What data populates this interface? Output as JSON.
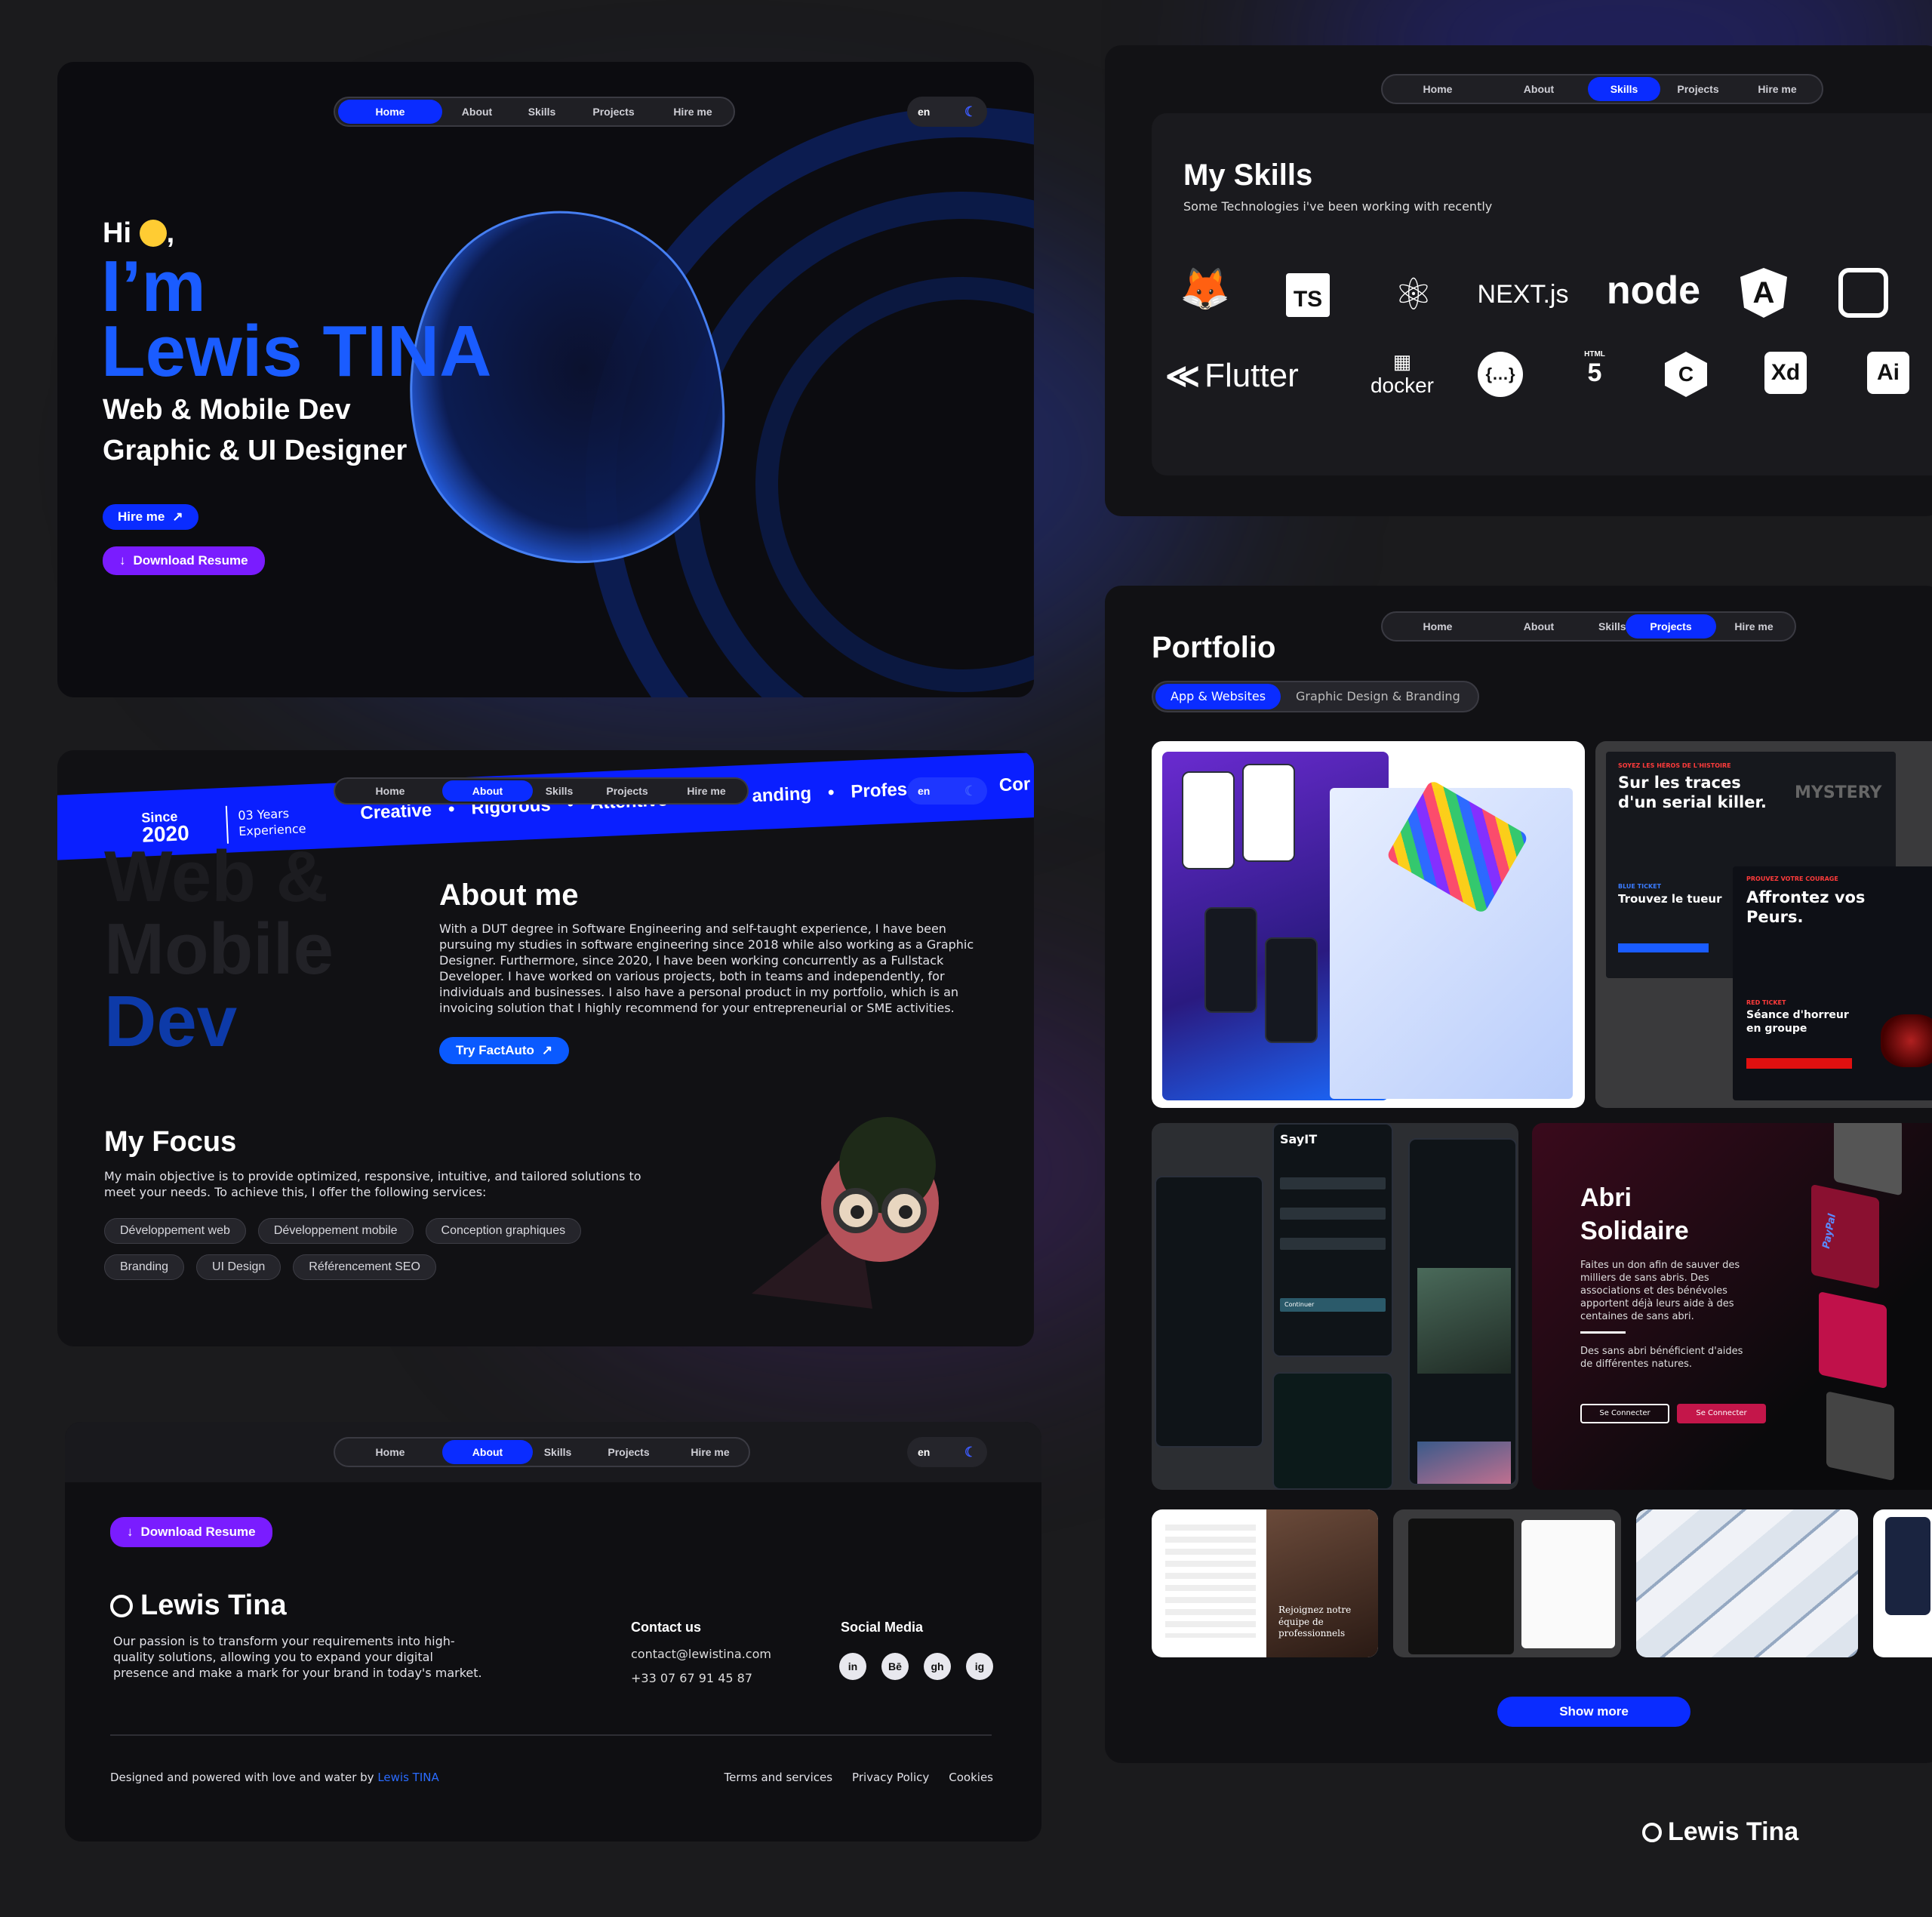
{
  "nav": {
    "home": "Home",
    "about": "About",
    "skills": "Skills",
    "projects": "Projects",
    "hire": "Hire me",
    "lang": "en"
  },
  "hero": {
    "hi": "Hi",
    "comma": ",",
    "im": "I’m",
    "name": "Lewis TINA",
    "role1": "Web & Mobile Dev",
    "role2": "Graphic & UI Designer",
    "hire_btn": "Hire me",
    "download_btn": "Download Resume"
  },
  "skills": {
    "title": "My Skills",
    "subtitle": "Some Technologies i've been working with recently",
    "row1": [
      "TS",
      "NEXT.js",
      "node"
    ],
    "row2": [
      "Flutter",
      "docker",
      "HTML",
      "Xd",
      "Ai"
    ]
  },
  "about": {
    "since_label": "Since",
    "since_year": "2020",
    "exp_years": "03 Years",
    "exp_label": "Experience",
    "ribbon": [
      "Creative",
      "•",
      "Rigorous",
      "•",
      "Attentive",
      "anding",
      "•",
      "Profes",
      "Cor"
    ],
    "bg_words": [
      "Web &",
      "Mobile",
      "Dev"
    ],
    "title": "About me",
    "text": "With a DUT degree in Software Engineering and self-taught experience, I have been pursuing my studies in software engineering since 2018 while also working as a Graphic Designer. Furthermore, since 2020, I have been working concurrently as a Fullstack Developer. I have worked on various projects, both in teams and independently, for individuals and businesses. I also have a personal product in my portfolio, which is an invoicing solution that I highly recommend for your entrepreneurial or SME activities.",
    "try_btn": "Try FactAuto",
    "focus_title": "My Focus",
    "focus_text": "My main objective is to provide optimized, responsive, intuitive, and tailored solutions to meet your needs. To achieve this, I offer the following services:",
    "services": [
      "Développement web",
      "Développement mobile",
      "Conception graphiques",
      "Branding",
      "UI Design",
      "Référencement SEO"
    ]
  },
  "portfolio": {
    "title": "Portfolio",
    "tab1": "App & Websites",
    "tab2": "Graphic Design & Branding",
    "show_more": "Show more",
    "mystery": {
      "kicker": "SOYEZ LES HÉROS DE L'HISTOIRE",
      "title": "Sur les traces d'un serial killer.",
      "blue": "BLUE TICKET",
      "blue_title": "Trouvez le tueur",
      "red_kicker": "PROUVEZ VOTRE COURAGE",
      "red_title": "Affrontez vos Peurs.",
      "red": "RED TICKET",
      "red_sub": "Séance d'horreur en groupe",
      "logo": "MYSTERY"
    },
    "sayit": {
      "title": "SayIT",
      "cta": "Continuer"
    },
    "abri": {
      "title1": "Abri",
      "title2": "Solidaire",
      "p1": "Faites un don afin de sauver des milliers de sans abris. Des associations et des bénévoles apportent déjà leurs aide à des centaines de sans abri.",
      "p2": "Des sans abri bénéficient d'aides de différentes natures.",
      "btn1": "Se Connecter",
      "btn2": "Se Connecter",
      "paypal": "PayPal"
    },
    "recruit": "Rejoignez notre équipe de professionnels"
  },
  "footer": {
    "download_btn": "Download Resume",
    "brand": "Lewis Tina",
    "text": "Our passion is to transform your requirements into high-quality solutions, allowing you to expand your digital presence and make a mark for your brand in today's market.",
    "contact_title": "Contact us",
    "email": "contact@lewistina.com",
    "phone": "+33 07 67 91 45 87",
    "social_title": "Social Media",
    "social": [
      "in",
      "Bē",
      "gh",
      "ig"
    ],
    "credit": "Designed and powered with love and water by",
    "credit_name": "Lewis TINA",
    "links": [
      "Terms and services",
      "Privacy Policy",
      "Cookies"
    ]
  },
  "watermark": "Lewis Tina",
  "colors": {
    "accent": "#0a2cff",
    "blue_text": "#1a5cff",
    "purple": "#7a1cff",
    "bg": "#1b1b1d"
  }
}
